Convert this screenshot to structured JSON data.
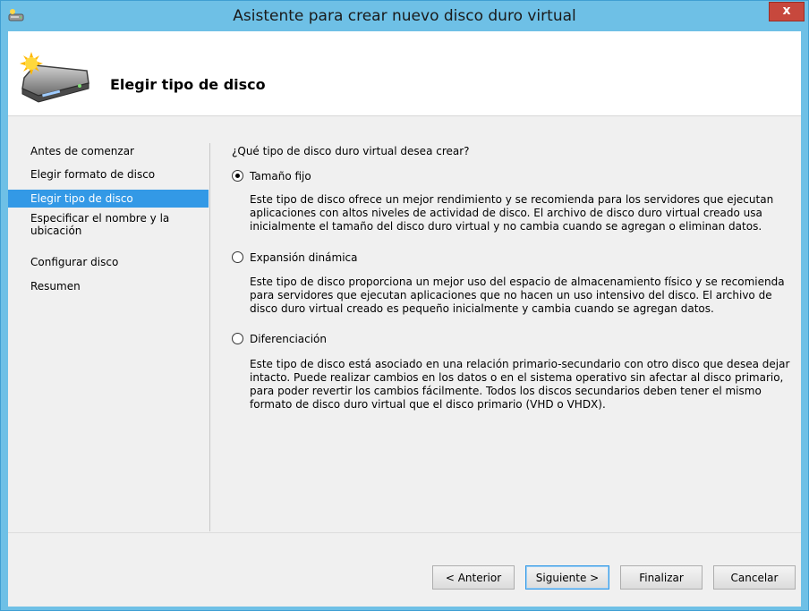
{
  "window": {
    "title": "Asistente para crear nuevo disco duro virtual",
    "close_glyph": "x"
  },
  "header": {
    "title": "Elegir tipo de disco",
    "icon": "virtual-disk-new-icon"
  },
  "nav": {
    "items": [
      {
        "label": "Antes de comenzar"
      },
      {
        "label": "Elegir formato de disco"
      },
      {
        "label": "Elegir tipo de disco"
      },
      {
        "label": "Especificar el nombre y la ubicación"
      },
      {
        "label": "Configurar disco"
      },
      {
        "label": "Resumen"
      }
    ],
    "active_index": 2
  },
  "content": {
    "question": "¿Qué tipo de disco duro virtual desea crear?",
    "options": [
      {
        "label": "Tamaño fijo",
        "selected": true,
        "description": "Este tipo de disco ofrece un mejor rendimiento y se recomienda para los servidores que ejecutan aplicaciones con altos niveles de actividad de disco. El archivo de disco duro virtual creado usa inicialmente el tamaño del disco duro virtual y no cambia cuando se agregan o eliminan datos."
      },
      {
        "label": "Expansión dinámica",
        "selected": false,
        "description": "Este tipo de disco proporciona un mejor uso del espacio de almacenamiento físico y se recomienda para servidores que ejecutan aplicaciones que no hacen un uso intensivo del disco. El archivo de disco duro virtual creado es pequeño inicialmente y cambia cuando se agregan datos."
      },
      {
        "label": "Diferenciación",
        "selected": false,
        "description": "Este tipo de disco está asociado en una relación primario-secundario con otro disco que desea dejar intacto. Puede realizar cambios en los datos o en el sistema operativo sin afectar al disco primario, para poder revertir los cambios fácilmente. Todos los discos secundarios deben tener el mismo formato de disco duro virtual que el disco primario (VHD o VHDX)."
      }
    ]
  },
  "footer": {
    "previous_label": "< Anterior",
    "next_label": "Siguiente >",
    "finish_label": "Finalizar",
    "cancel_label": "Cancelar"
  },
  "colors": {
    "frame": "#6ec0e6",
    "nav_active": "#3399e6",
    "close_button": "#c7483d"
  }
}
